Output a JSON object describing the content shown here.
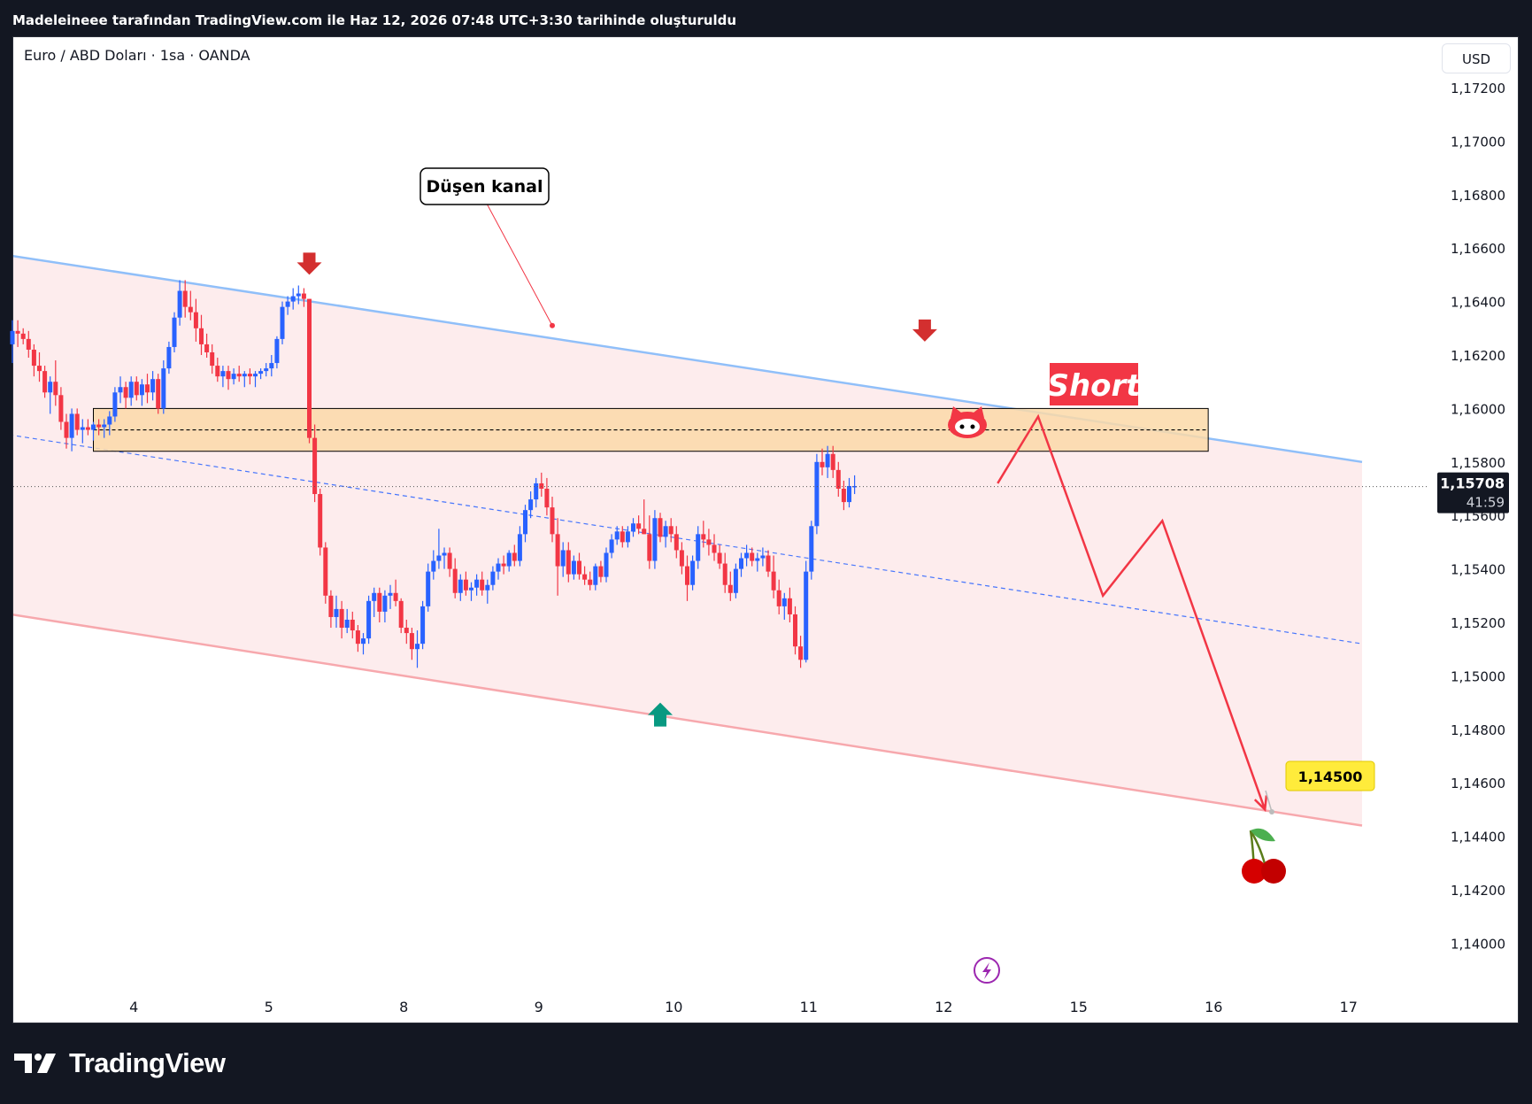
{
  "header": {
    "attribution": "Madeleineee tarafından TradingView.com ile Haz 12, 2026 07:48 UTC+3:30 tarihinde oluşturuldu"
  },
  "chart": {
    "symbol_legend": "Euro / ABD Doları · 1sa · OANDA",
    "currency": "USD",
    "current_price_label": "1,15708",
    "countdown": "41:59"
  },
  "chart_data": {
    "type": "candlestick",
    "title": "Euro / ABD Doları · 1sa · OANDA",
    "currency": "USD",
    "y_tick_labels": [
      "1,17200",
      "1,17000",
      "1,16800",
      "1,16600",
      "1,16400",
      "1,16200",
      "1,16000",
      "1,15800",
      "1,15600",
      "1,15400",
      "1,15200",
      "1,15000",
      "1,14800",
      "1,14600",
      "1,14400",
      "1,14200",
      "1,14000"
    ],
    "y_ticks": [
      1.172,
      1.17,
      1.168,
      1.166,
      1.164,
      1.162,
      1.16,
      1.158,
      1.156,
      1.154,
      1.152,
      1.15,
      1.148,
      1.146,
      1.144,
      1.142,
      1.14
    ],
    "x_tick_labels": [
      "4",
      "5",
      "8",
      "9",
      "10",
      "11",
      "12",
      "15",
      "16",
      "17"
    ],
    "x_tick_sessions": [
      0.9,
      1.9,
      2.9,
      3.9,
      4.9,
      5.9,
      6.9,
      7.9,
      8.9,
      9.9
    ],
    "ylim": [
      1.1387,
      1.1743
    ],
    "xlim": [
      0,
      10.15
    ],
    "grid": false,
    "current_price": 1.15708,
    "candles": [
      [
        0.0,
        1.1624,
        1.1633,
        1.1617,
        1.1629
      ],
      [
        0.04,
        1.1629,
        1.1633,
        1.1623,
        1.1628
      ],
      [
        0.08,
        1.1628,
        1.163,
        1.1624,
        1.1626
      ],
      [
        0.12,
        1.1626,
        1.1629,
        1.1619,
        1.1622
      ],
      [
        0.16,
        1.1622,
        1.1624,
        1.1612,
        1.1616
      ],
      [
        0.2,
        1.1616,
        1.1621,
        1.161,
        1.1614
      ],
      [
        0.24,
        1.1614,
        1.1616,
        1.1604,
        1.1606
      ],
      [
        0.28,
        1.1606,
        1.1612,
        1.1598,
        1.161
      ],
      [
        0.32,
        1.161,
        1.1618,
        1.1601,
        1.1605
      ],
      [
        0.36,
        1.1605,
        1.1608,
        1.1592,
        1.1595
      ],
      [
        0.4,
        1.1595,
        1.1598,
        1.1585,
        1.1589
      ],
      [
        0.44,
        1.1589,
        1.16,
        1.1584,
        1.1598
      ],
      [
        0.48,
        1.1598,
        1.16,
        1.159,
        1.1592
      ],
      [
        0.52,
        1.1592,
        1.1596,
        1.1587,
        1.1593
      ],
      [
        0.56,
        1.1593,
        1.1596,
        1.159,
        1.1592
      ],
      [
        0.6,
        1.1592,
        1.1595,
        1.1588,
        1.1594
      ],
      [
        0.64,
        1.1594,
        1.1596,
        1.159,
        1.1593
      ],
      [
        0.68,
        1.1593,
        1.1596,
        1.1589,
        1.1594
      ],
      [
        0.72,
        1.1594,
        1.1599,
        1.159,
        1.1597
      ],
      [
        0.76,
        1.1597,
        1.1608,
        1.1595,
        1.1606
      ],
      [
        0.8,
        1.1606,
        1.1612,
        1.1602,
        1.1608
      ],
      [
        0.84,
        1.1608,
        1.161,
        1.16,
        1.1604
      ],
      [
        0.88,
        1.1604,
        1.1612,
        1.1601,
        1.161
      ],
      [
        0.92,
        1.161,
        1.1612,
        1.1603,
        1.1605
      ],
      [
        0.96,
        1.1605,
        1.1611,
        1.1601,
        1.1609
      ],
      [
        1.0,
        1.1609,
        1.1613,
        1.1602,
        1.1606
      ],
      [
        1.04,
        1.1606,
        1.1614,
        1.1603,
        1.1611
      ],
      [
        1.08,
        1.1611,
        1.1613,
        1.1598,
        1.16
      ],
      [
        1.12,
        1.16,
        1.1618,
        1.1598,
        1.1615
      ],
      [
        1.16,
        1.1615,
        1.1625,
        1.1613,
        1.1623
      ],
      [
        1.2,
        1.1623,
        1.1636,
        1.1621,
        1.1634
      ],
      [
        1.24,
        1.1634,
        1.1648,
        1.1631,
        1.1644
      ],
      [
        1.28,
        1.1644,
        1.1648,
        1.1634,
        1.1638
      ],
      [
        1.32,
        1.1638,
        1.1644,
        1.1633,
        1.1636
      ],
      [
        1.36,
        1.1636,
        1.1641,
        1.1625,
        1.163
      ],
      [
        1.4,
        1.163,
        1.1635,
        1.162,
        1.1624
      ],
      [
        1.44,
        1.1624,
        1.1628,
        1.1619,
        1.1621
      ],
      [
        1.48,
        1.1621,
        1.1624,
        1.1613,
        1.1616
      ],
      [
        1.52,
        1.1616,
        1.1619,
        1.161,
        1.1612
      ],
      [
        1.56,
        1.1612,
        1.1616,
        1.1608,
        1.1614
      ],
      [
        1.6,
        1.1614,
        1.1616,
        1.1607,
        1.1611
      ],
      [
        1.64,
        1.1611,
        1.1615,
        1.1609,
        1.1613
      ],
      [
        1.68,
        1.1613,
        1.1616,
        1.161,
        1.1612
      ],
      [
        1.72,
        1.1612,
        1.1614,
        1.1608,
        1.1613
      ],
      [
        1.76,
        1.1613,
        1.1615,
        1.1609,
        1.1612
      ],
      [
        1.8,
        1.1612,
        1.1614,
        1.1608,
        1.1613
      ],
      [
        1.84,
        1.1613,
        1.1615,
        1.1611,
        1.1614
      ],
      [
        1.88,
        1.1614,
        1.1617,
        1.1612,
        1.1615
      ],
      [
        1.92,
        1.1615,
        1.162,
        1.1612,
        1.1617
      ],
      [
        1.96,
        1.1617,
        1.1627,
        1.1615,
        1.1626
      ],
      [
        2.0,
        1.1626,
        1.164,
        1.1624,
        1.1638
      ],
      [
        2.04,
        1.1638,
        1.1642,
        1.1635,
        1.164
      ],
      [
        2.08,
        1.164,
        1.1645,
        1.1637,
        1.1642
      ],
      [
        2.12,
        1.1642,
        1.1646,
        1.1639,
        1.1643
      ],
      [
        2.16,
        1.1643,
        1.1645,
        1.1638,
        1.1641
      ],
      [
        2.2,
        1.1641,
        1.1641,
        1.1587,
        1.1589
      ],
      [
        2.24,
        1.1589,
        1.1594,
        1.1565,
        1.1568
      ],
      [
        2.28,
        1.1568,
        1.157,
        1.1545,
        1.1548
      ],
      [
        2.32,
        1.1548,
        1.155,
        1.1527,
        1.153
      ],
      [
        2.36,
        1.153,
        1.1532,
        1.1518,
        1.1522
      ],
      [
        2.4,
        1.1522,
        1.153,
        1.1518,
        1.1525
      ],
      [
        2.44,
        1.1525,
        1.1528,
        1.1514,
        1.1518
      ],
      [
        2.48,
        1.1518,
        1.1525,
        1.1516,
        1.1521
      ],
      [
        2.52,
        1.1521,
        1.1524,
        1.1514,
        1.1517
      ],
      [
        2.56,
        1.1517,
        1.1519,
        1.1509,
        1.1512
      ],
      [
        2.6,
        1.1512,
        1.1516,
        1.1508,
        1.1514
      ],
      [
        2.64,
        1.1514,
        1.153,
        1.1512,
        1.1528
      ],
      [
        2.68,
        1.1528,
        1.1533,
        1.1522,
        1.1531
      ],
      [
        2.72,
        1.1531,
        1.1533,
        1.152,
        1.1524
      ],
      [
        2.76,
        1.1524,
        1.1532,
        1.152,
        1.153
      ],
      [
        2.8,
        1.153,
        1.1534,
        1.1525,
        1.1531
      ],
      [
        2.84,
        1.1531,
        1.1536,
        1.1526,
        1.1528
      ],
      [
        2.88,
        1.1528,
        1.1529,
        1.1516,
        1.1518
      ],
      [
        2.92,
        1.1518,
        1.1521,
        1.1512,
        1.1516
      ],
      [
        2.96,
        1.1516,
        1.1518,
        1.1506,
        1.151
      ],
      [
        3.0,
        1.151,
        1.1517,
        1.1503,
        1.1512
      ],
      [
        3.04,
        1.1512,
        1.1528,
        1.151,
        1.1526
      ],
      [
        3.08,
        1.1526,
        1.1542,
        1.1524,
        1.1539
      ],
      [
        3.12,
        1.1539,
        1.1547,
        1.1536,
        1.1543
      ],
      [
        3.16,
        1.1543,
        1.1555,
        1.154,
        1.1545
      ],
      [
        3.2,
        1.1545,
        1.1548,
        1.154,
        1.1546
      ],
      [
        3.24,
        1.1546,
        1.1548,
        1.1537,
        1.154
      ],
      [
        3.28,
        1.154,
        1.1544,
        1.1529,
        1.1531
      ],
      [
        3.32,
        1.1531,
        1.1538,
        1.1528,
        1.1536
      ],
      [
        3.36,
        1.1536,
        1.1539,
        1.153,
        1.1532
      ],
      [
        3.4,
        1.1532,
        1.1535,
        1.1528,
        1.1533
      ],
      [
        3.44,
        1.1533,
        1.1538,
        1.153,
        1.1536
      ],
      [
        3.48,
        1.1536,
        1.1539,
        1.153,
        1.1532
      ],
      [
        3.52,
        1.1532,
        1.1536,
        1.1527,
        1.1534
      ],
      [
        3.56,
        1.1534,
        1.1541,
        1.1532,
        1.1539
      ],
      [
        3.6,
        1.1539,
        1.1544,
        1.1536,
        1.1542
      ],
      [
        3.64,
        1.1542,
        1.1545,
        1.1538,
        1.1541
      ],
      [
        3.68,
        1.1541,
        1.1547,
        1.1539,
        1.1546
      ],
      [
        3.72,
        1.1546,
        1.1549,
        1.1541,
        1.1543
      ],
      [
        3.76,
        1.1543,
        1.1556,
        1.1541,
        1.1553
      ],
      [
        3.8,
        1.1553,
        1.1564,
        1.155,
        1.1562
      ],
      [
        3.84,
        1.1562,
        1.1569,
        1.1559,
        1.1566
      ],
      [
        3.88,
        1.1566,
        1.1574,
        1.1563,
        1.1572
      ],
      [
        3.92,
        1.1572,
        1.1576,
        1.1567,
        1.157
      ],
      [
        3.96,
        1.157,
        1.1574,
        1.156,
        1.1563
      ],
      [
        4.0,
        1.1563,
        1.1567,
        1.155,
        1.1553
      ],
      [
        4.04,
        1.1553,
        1.1559,
        1.153,
        1.1541
      ],
      [
        4.08,
        1.1541,
        1.155,
        1.1537,
        1.1547
      ],
      [
        4.12,
        1.1547,
        1.155,
        1.1535,
        1.1538
      ],
      [
        4.16,
        1.1538,
        1.1545,
        1.1536,
        1.1543
      ],
      [
        4.2,
        1.1543,
        1.1546,
        1.1536,
        1.1538
      ],
      [
        4.24,
        1.1538,
        1.1541,
        1.1534,
        1.1536
      ],
      [
        4.28,
        1.1536,
        1.1539,
        1.1532,
        1.1534
      ],
      [
        4.32,
        1.1534,
        1.1542,
        1.1532,
        1.1541
      ],
      [
        4.36,
        1.1541,
        1.1543,
        1.1535,
        1.1537
      ],
      [
        4.4,
        1.1537,
        1.1548,
        1.1535,
        1.1546
      ],
      [
        4.44,
        1.1546,
        1.1553,
        1.1544,
        1.1551
      ],
      [
        4.48,
        1.1551,
        1.1556,
        1.1549,
        1.1554
      ],
      [
        4.52,
        1.1554,
        1.1556,
        1.1548,
        1.155
      ],
      [
        4.56,
        1.155,
        1.1556,
        1.1548,
        1.1554
      ],
      [
        4.6,
        1.1554,
        1.1559,
        1.1552,
        1.1557
      ],
      [
        4.64,
        1.1557,
        1.156,
        1.1553,
        1.1555
      ],
      [
        4.68,
        1.1555,
        1.1566,
        1.1553,
        1.1553
      ],
      [
        4.72,
        1.1553,
        1.156,
        1.154,
        1.1543
      ],
      [
        4.76,
        1.1543,
        1.1562,
        1.154,
        1.1559
      ],
      [
        4.8,
        1.1559,
        1.1561,
        1.155,
        1.1552
      ],
      [
        4.84,
        1.1552,
        1.1558,
        1.1548,
        1.1556
      ],
      [
        4.88,
        1.1556,
        1.1559,
        1.155,
        1.1553
      ],
      [
        4.92,
        1.1553,
        1.1556,
        1.1544,
        1.1547
      ],
      [
        4.96,
        1.1547,
        1.155,
        1.1538,
        1.1541
      ],
      [
        5.0,
        1.1541,
        1.1545,
        1.1528,
        1.1534
      ],
      [
        5.04,
        1.1534,
        1.1545,
        1.1532,
        1.1543
      ],
      [
        5.08,
        1.1543,
        1.1556,
        1.154,
        1.1553
      ],
      [
        5.12,
        1.1553,
        1.1558,
        1.1548,
        1.1551
      ],
      [
        5.16,
        1.1551,
        1.1555,
        1.1545,
        1.1549
      ],
      [
        5.2,
        1.1549,
        1.1553,
        1.1543,
        1.1546
      ],
      [
        5.24,
        1.1546,
        1.1549,
        1.154,
        1.1542
      ],
      [
        5.28,
        1.1542,
        1.1546,
        1.1531,
        1.1534
      ],
      [
        5.32,
        1.1534,
        1.1539,
        1.1528,
        1.1531
      ],
      [
        5.36,
        1.1531,
        1.1542,
        1.1529,
        1.154
      ],
      [
        5.4,
        1.154,
        1.1546,
        1.1537,
        1.1544
      ],
      [
        5.44,
        1.1544,
        1.1549,
        1.1541,
        1.1546
      ],
      [
        5.48,
        1.1546,
        1.1548,
        1.1541,
        1.1543
      ],
      [
        5.52,
        1.1543,
        1.1546,
        1.1539,
        1.1544
      ],
      [
        5.56,
        1.1544,
        1.1548,
        1.1541,
        1.1545
      ],
      [
        5.6,
        1.1545,
        1.1547,
        1.1537,
        1.1539
      ],
      [
        5.64,
        1.1539,
        1.1545,
        1.1529,
        1.1532
      ],
      [
        5.68,
        1.1532,
        1.1536,
        1.1523,
        1.1526
      ],
      [
        5.72,
        1.1526,
        1.1531,
        1.1521,
        1.1529
      ],
      [
        5.76,
        1.1529,
        1.1533,
        1.152,
        1.1523
      ],
      [
        5.8,
        1.1523,
        1.1526,
        1.1508,
        1.1511
      ],
      [
        5.84,
        1.1511,
        1.1515,
        1.1503,
        1.1506
      ],
      [
        5.88,
        1.1506,
        1.1543,
        1.1505,
        1.1539
      ],
      [
        5.92,
        1.1539,
        1.1558,
        1.1536,
        1.1556
      ],
      [
        5.96,
        1.1556,
        1.1583,
        1.1553,
        1.158
      ],
      [
        6.0,
        1.158,
        1.1585,
        1.1575,
        1.1578
      ],
      [
        6.04,
        1.1578,
        1.1586,
        1.1574,
        1.1583
      ],
      [
        6.08,
        1.1583,
        1.1586,
        1.1574,
        1.1577
      ],
      [
        6.12,
        1.1577,
        1.158,
        1.1567,
        1.157
      ],
      [
        6.16,
        1.157,
        1.1573,
        1.1562,
        1.1565
      ],
      [
        6.2,
        1.1565,
        1.1574,
        1.1563,
        1.1571
      ],
      [
        6.24,
        1.1571,
        1.1575,
        1.1568,
        1.1571
      ]
    ],
    "annotations": [
      {
        "type": "callout",
        "text": "Düşen kanal",
        "target": [
          4.0,
          1.1631
        ]
      },
      {
        "type": "label",
        "text": "Short"
      },
      {
        "type": "price_label",
        "text": "1,14500",
        "value": 1.145
      },
      {
        "type": "arrow_down",
        "at": [
          2.2,
          1.1651
        ]
      },
      {
        "type": "arrow_up",
        "at": [
          4.8,
          1.149
        ]
      },
      {
        "type": "arrow_down",
        "at": [
          6.76,
          1.1626
        ]
      }
    ],
    "descending_channel": {
      "upper": [
        [
          -0.9,
          1.1664
        ],
        [
          10.0,
          1.158
        ]
      ],
      "lower": [
        [
          -0.9,
          1.153
        ],
        [
          10.0,
          1.1444
        ]
      ],
      "middle": [
        [
          -0.9,
          1.1597
        ],
        [
          10.0,
          1.1512
        ]
      ]
    },
    "resistance_zone": {
      "from": 1.1584,
      "to": 1.16,
      "x_start": 0.6,
      "x_end": 8.86,
      "dashed_level": 1.1592
    },
    "projected_path": [
      [
        7.3,
        1.1572
      ],
      [
        7.6,
        1.1597
      ],
      [
        8.08,
        1.153
      ],
      [
        8.52,
        1.1558
      ],
      [
        9.28,
        1.145
      ]
    ]
  },
  "footer": {
    "logo_text": "TradingView"
  },
  "colors": {
    "bull": "#2962ff",
    "bear": "#f23645",
    "channel_upper": "#90bff9",
    "channel_lower": "#f7a8ad",
    "channel_fill": "#fdeced",
    "zone_fill": "#fcd9a8",
    "zone_border": "#000000",
    "projection": "#f23645",
    "price_tag": "#131722",
    "target_label": "#ffeb3b",
    "short_badge": "#f23645",
    "up_arrow": "#089981",
    "down_arrow": "#d32f2f",
    "lightning": "#9c27b0"
  }
}
